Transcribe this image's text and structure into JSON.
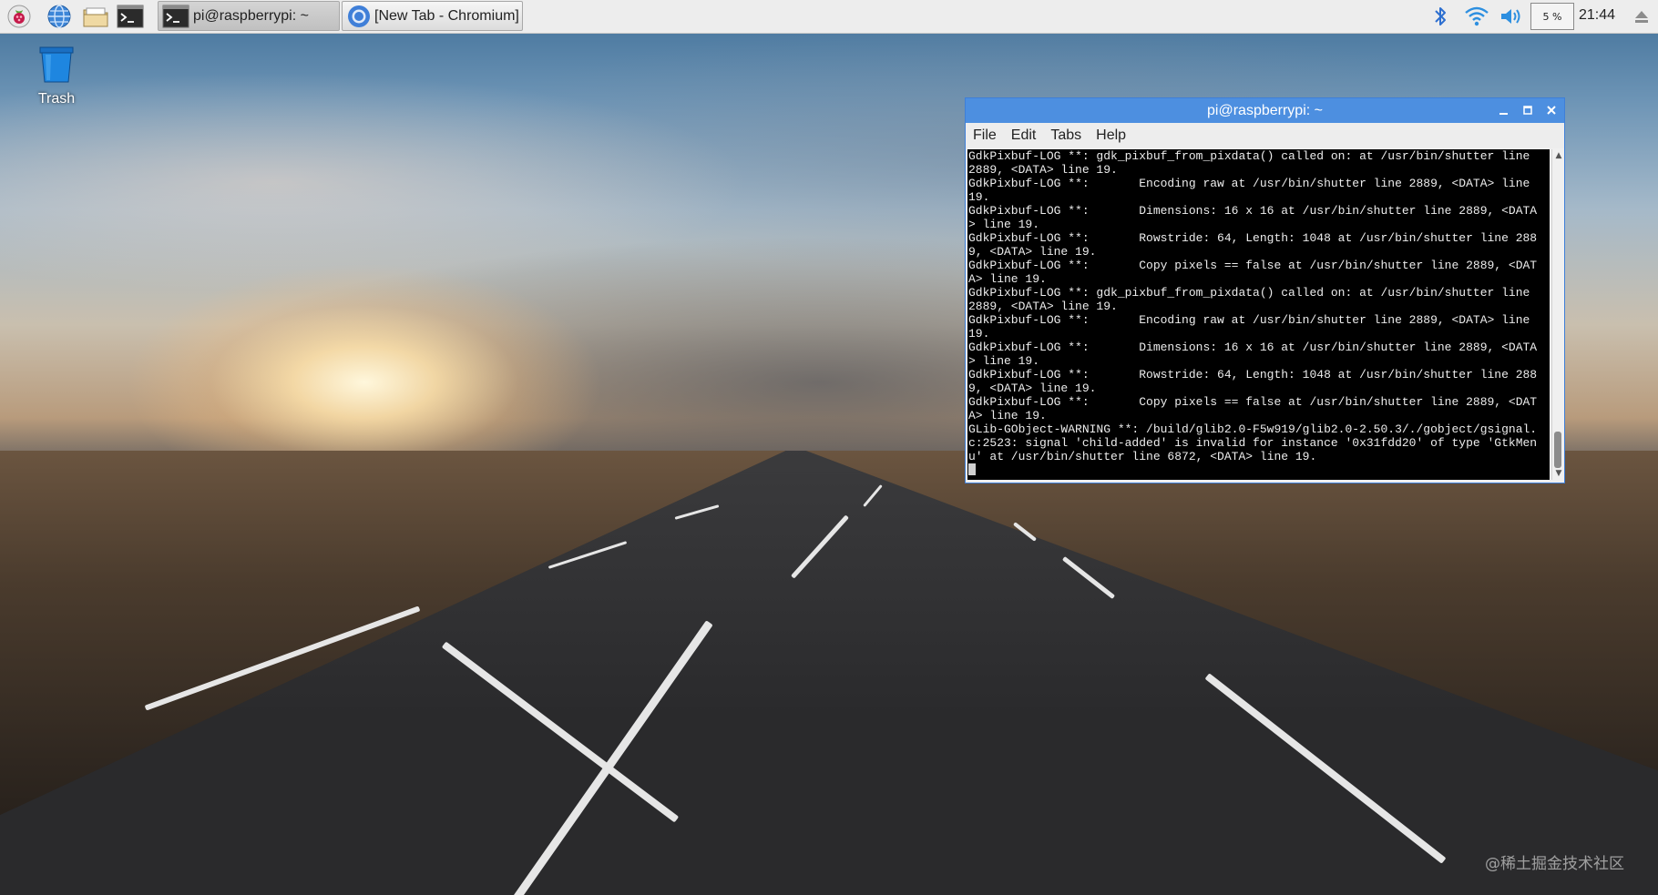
{
  "panel": {
    "launchers": [
      {
        "name": "raspberry-menu-icon"
      },
      {
        "name": "web-browser-icon"
      },
      {
        "name": "file-manager-icon"
      },
      {
        "name": "terminal-icon"
      }
    ],
    "tasks": [
      {
        "label": "pi@raspberrypi: ~",
        "icon": "terminal-icon",
        "active": true
      },
      {
        "label": "[New Tab - Chromium]",
        "icon": "chromium-icon",
        "active": false
      }
    ],
    "cpu_usage": "5 %",
    "clock": "21:44"
  },
  "desktop": {
    "trash_label": "Trash"
  },
  "terminal": {
    "title": "pi@raspberrypi: ~",
    "menu": [
      "File",
      "Edit",
      "Tabs",
      "Help"
    ],
    "lines": [
      "GdkPixbuf-LOG **: gdk_pixbuf_from_pixdata() called on: at /usr/bin/shutter line",
      "2889, <DATA> line 19.",
      "GdkPixbuf-LOG **:       Encoding raw at /usr/bin/shutter line 2889, <DATA> line",
      "19.",
      "GdkPixbuf-LOG **:       Dimensions: 16 x 16 at /usr/bin/shutter line 2889, <DATA",
      "> line 19.",
      "GdkPixbuf-LOG **:       Rowstride: 64, Length: 1048 at /usr/bin/shutter line 288",
      "9, <DATA> line 19.",
      "GdkPixbuf-LOG **:       Copy pixels == false at /usr/bin/shutter line 2889, <DAT",
      "A> line 19.",
      "GdkPixbuf-LOG **: gdk_pixbuf_from_pixdata() called on: at /usr/bin/shutter line",
      "2889, <DATA> line 19.",
      "GdkPixbuf-LOG **:       Encoding raw at /usr/bin/shutter line 2889, <DATA> line",
      "19.",
      "GdkPixbuf-LOG **:       Dimensions: 16 x 16 at /usr/bin/shutter line 2889, <DATA",
      "> line 19.",
      "GdkPixbuf-LOG **:       Rowstride: 64, Length: 1048 at /usr/bin/shutter line 288",
      "9, <DATA> line 19.",
      "GdkPixbuf-LOG **:       Copy pixels == false at /usr/bin/shutter line 2889, <DAT",
      "A> line 19.",
      "GLib-GObject-WARNING **: /build/glib2.0-F5w919/glib2.0-2.50.3/./gobject/gsignal.",
      "c:2523: signal 'child-added' is invalid for instance '0x31fdd20' of type 'GtkMen",
      "u' at /usr/bin/shutter line 6872, <DATA> line 19."
    ]
  },
  "watermark": "@稀土掘金技术社区",
  "colors": {
    "titlebar": "#4d8fe0",
    "panel": "#ededed",
    "terminal_bg": "#000000",
    "trash_blue": "#1e7fd6"
  }
}
